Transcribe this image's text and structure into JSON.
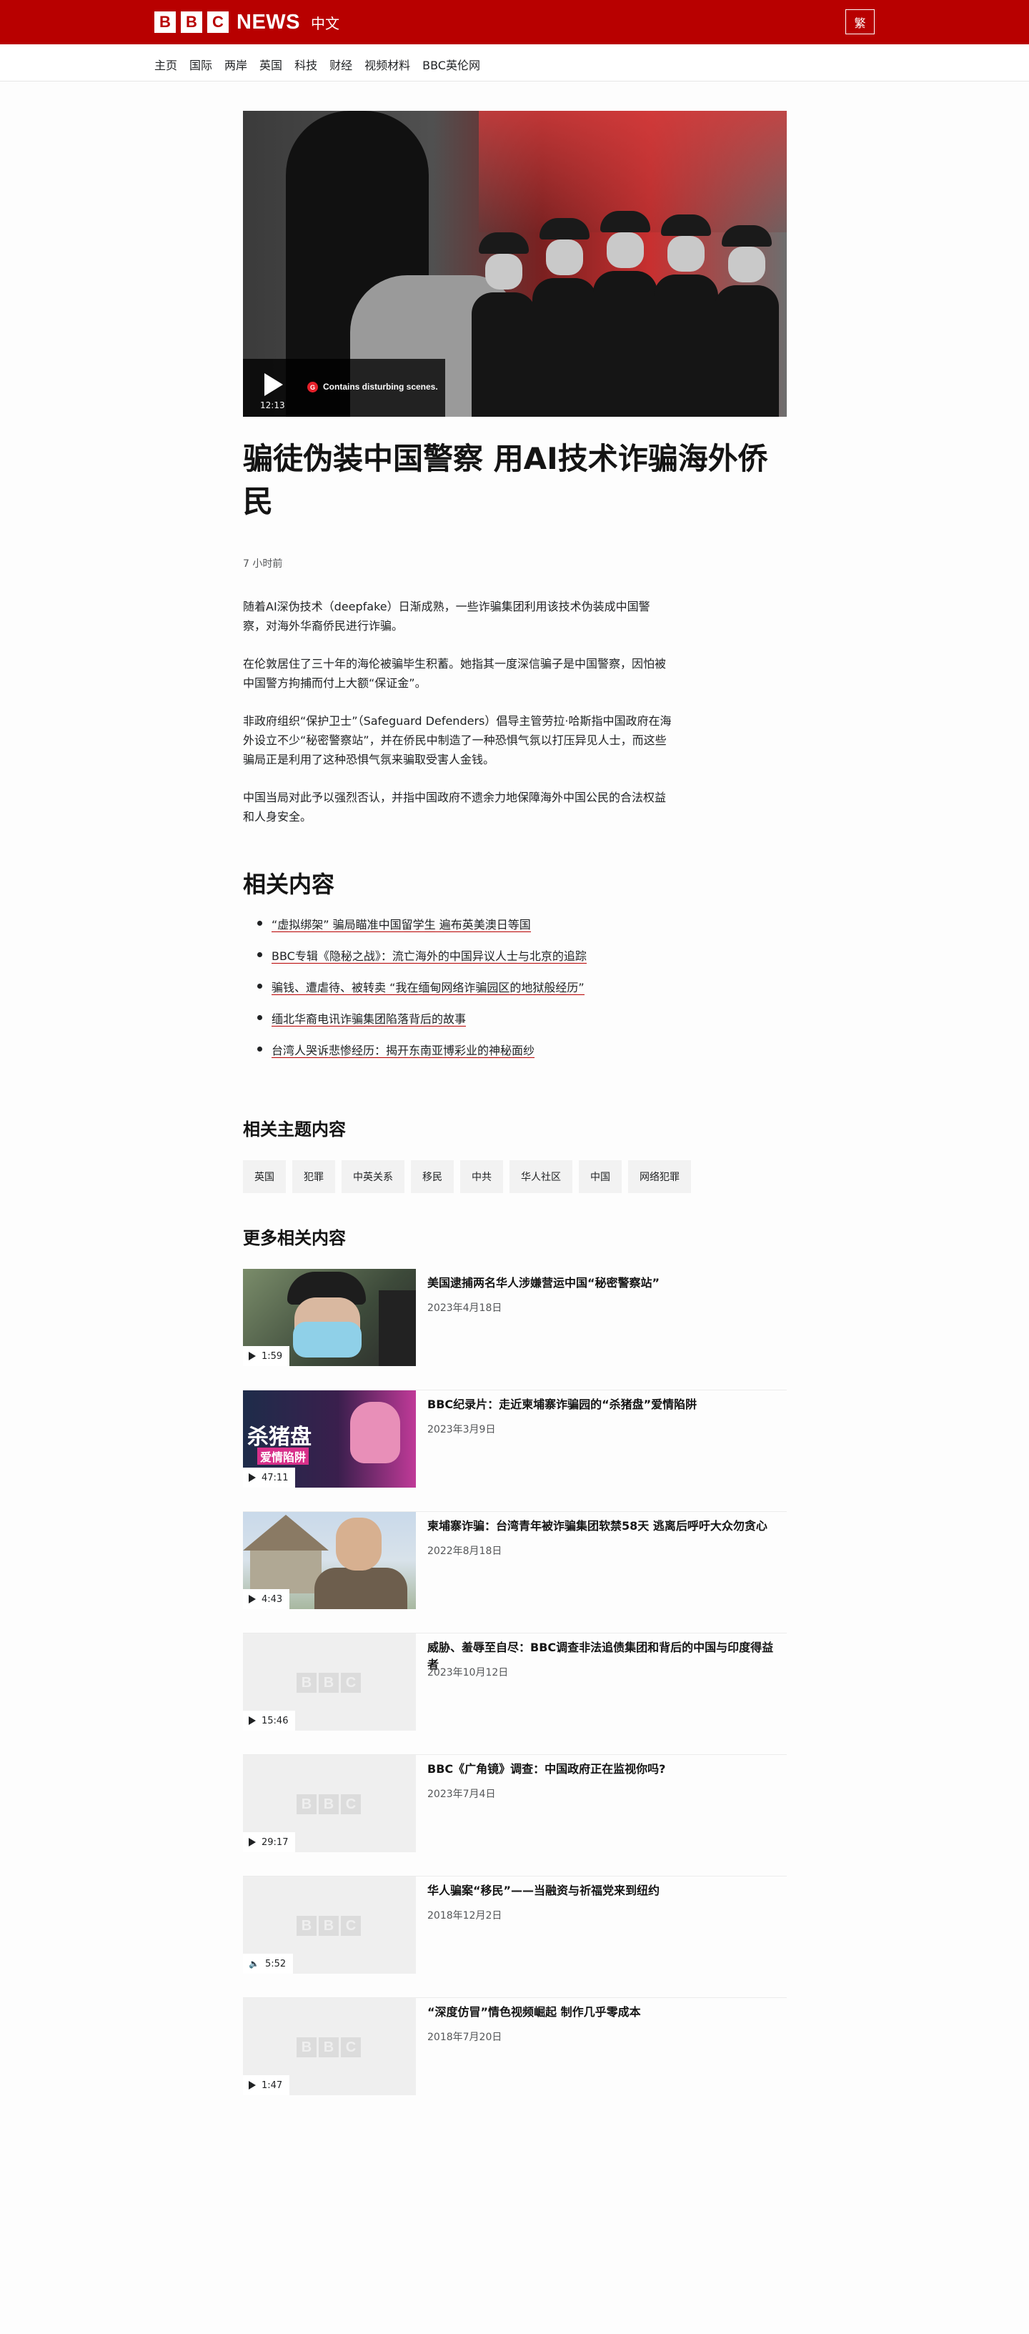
{
  "header": {
    "logo_letters": [
      "B",
      "B",
      "C"
    ],
    "logo_news": "NEWS",
    "logo_lang": "中文",
    "script_toggle": "繁"
  },
  "nav": {
    "items": [
      "主页",
      "国际",
      "两岸",
      "英国",
      "科技",
      "财经",
      "视频材料",
      "BBC英伦网"
    ]
  },
  "hero": {
    "duration": "12:13",
    "guidance_badge": "G",
    "warning": "Contains disturbing scenes."
  },
  "article": {
    "headline": "骗徒伪装中国警察 用AI技术诈骗海外侨民",
    "timestamp": "7 小时前",
    "paragraphs": [
      "随着AI深伪技术（deepfake）日渐成熟，一些诈骗集团利用该技术伪装成中国警察，对海外华裔侨民进行诈骗。",
      "在伦敦居住了三十年的海伦被骗毕生积蓄。她指其一度深信骗子是中国警察，因怕被中国警方拘捕而付上大额“保证金”。",
      "非政府组织“保护卫士”（Safeguard Defenders）倡导主管劳拉·哈斯指中国政府在海外设立不少“秘密警察站”，并在侨民中制造了一种恐惧气氛以打压异见人士，而这些骗局正是利用了这种恐惧气氛来骗取受害人金钱。",
      "中国当局对此予以强烈否认，并指中国政府不遗余力地保障海外中国公民的合法权益和人身安全。"
    ]
  },
  "related": {
    "heading": "相关内容",
    "links": [
      "“虚拟绑架” 骗局瞄准中国留学生 遍布英美澳日等国",
      "BBC专辑《隐秘之战》：流亡海外的中国异议人士与北京的追踪",
      "骗钱、遭虐待、被转卖 “我在缅甸网络诈骗园区的地狱般经历”",
      "缅北华裔电讯诈骗集团陷落背后的故事",
      "台湾人哭诉悲惨经历：揭开东南亚博彩业的神秘面纱"
    ]
  },
  "topics": {
    "heading": "相关主题内容",
    "tags": [
      "英国",
      "犯罪",
      "中英关系",
      "移民",
      "中共",
      "华人社区",
      "中国",
      "网络犯罪"
    ]
  },
  "more": {
    "heading": "更多相关内容",
    "items": [
      {
        "title": "美国逮捕两名华人涉嫌营运中国“秘密警察站”",
        "date": "2023年4月18日",
        "duration": "1:59",
        "media": "video"
      },
      {
        "title": "BBC纪录片：走近柬埔寨诈骗园的“杀猪盘”爱情陷阱",
        "date": "2023年3月9日",
        "duration": "47:11",
        "media": "video",
        "thumb_text_1": "杀猪盘",
        "thumb_text_2": "爱情陷阱"
      },
      {
        "title": "柬埔寨诈骗：台湾青年被诈骗集团软禁58天 逃离后呼吁大众勿贪心",
        "date": "2022年8月18日",
        "duration": "4:43",
        "media": "video"
      },
      {
        "title": "威胁、羞辱至自尽：BBC调查非法追债集团和背后的中国与印度得益者",
        "date": "2023年10月12日",
        "duration": "15:46",
        "media": "video"
      },
      {
        "title": "BBC《广角镜》调查：中国政府正在监视你吗?",
        "date": "2023年7月4日",
        "duration": "29:17",
        "media": "video"
      },
      {
        "title": "华人骗案“移民”——当融资与祈福党来到纽约",
        "date": "2018年12月2日",
        "duration": "5:52",
        "media": "audio"
      },
      {
        "title": "“深度仿冒”情色视频崛起 制作几乎零成本",
        "date": "2018年7月20日",
        "duration": "1:47",
        "media": "video"
      }
    ]
  },
  "colors": {
    "brand_red": "#b80000",
    "text": "#141414",
    "muted": "#545658"
  }
}
